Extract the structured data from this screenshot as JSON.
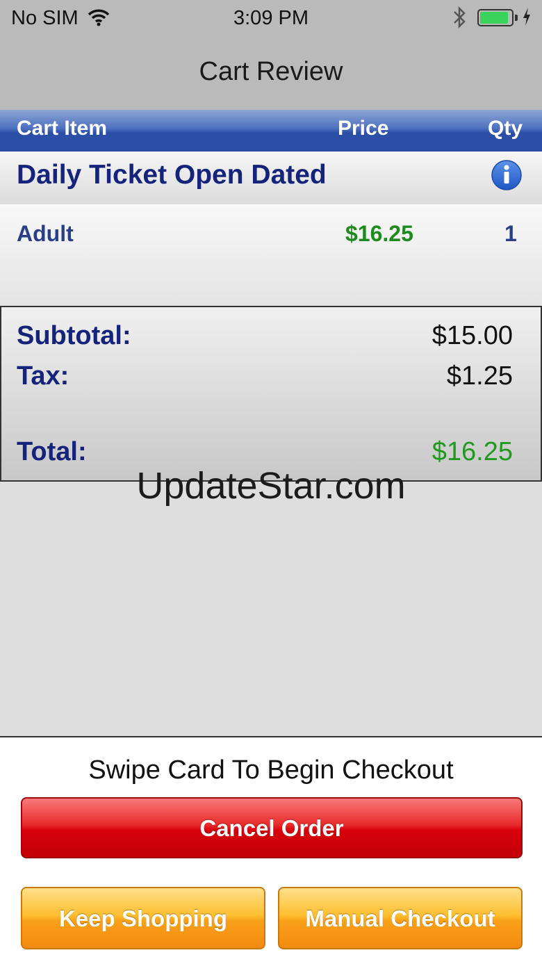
{
  "status_bar": {
    "carrier": "No SIM",
    "time": "3:09 PM",
    "battery_level": 0.9,
    "icons": [
      "wifi-icon",
      "bluetooth-icon",
      "battery-icon",
      "charging-icon"
    ]
  },
  "nav": {
    "title": "Cart Review"
  },
  "columns": {
    "item": "Cart Item",
    "price": "Price",
    "qty": "Qty"
  },
  "section": {
    "title": "Daily Ticket Open Dated",
    "icon": "info-icon"
  },
  "items": [
    {
      "name": "Adult",
      "price": "$16.25",
      "qty": "1"
    }
  ],
  "totals": {
    "subtotal_label": "Subtotal:",
    "subtotal_value": "$15.00",
    "tax_label": "Tax:",
    "tax_value": "$1.25",
    "total_label": "Total:",
    "total_value": "$16.25"
  },
  "watermark": "UpdateStar.com",
  "checkout": {
    "prompt": "Swipe Card To Begin Checkout",
    "cancel_label": "Cancel Order",
    "keep_shopping_label": "Keep Shopping",
    "manual_checkout_label": "Manual Checkout"
  },
  "colors": {
    "header_blue": "#2b4fa6",
    "title_navy": "#15237a",
    "price_green": "#1f8a1f",
    "cancel_red": "#d6000a",
    "action_orange": "#f9a018"
  }
}
